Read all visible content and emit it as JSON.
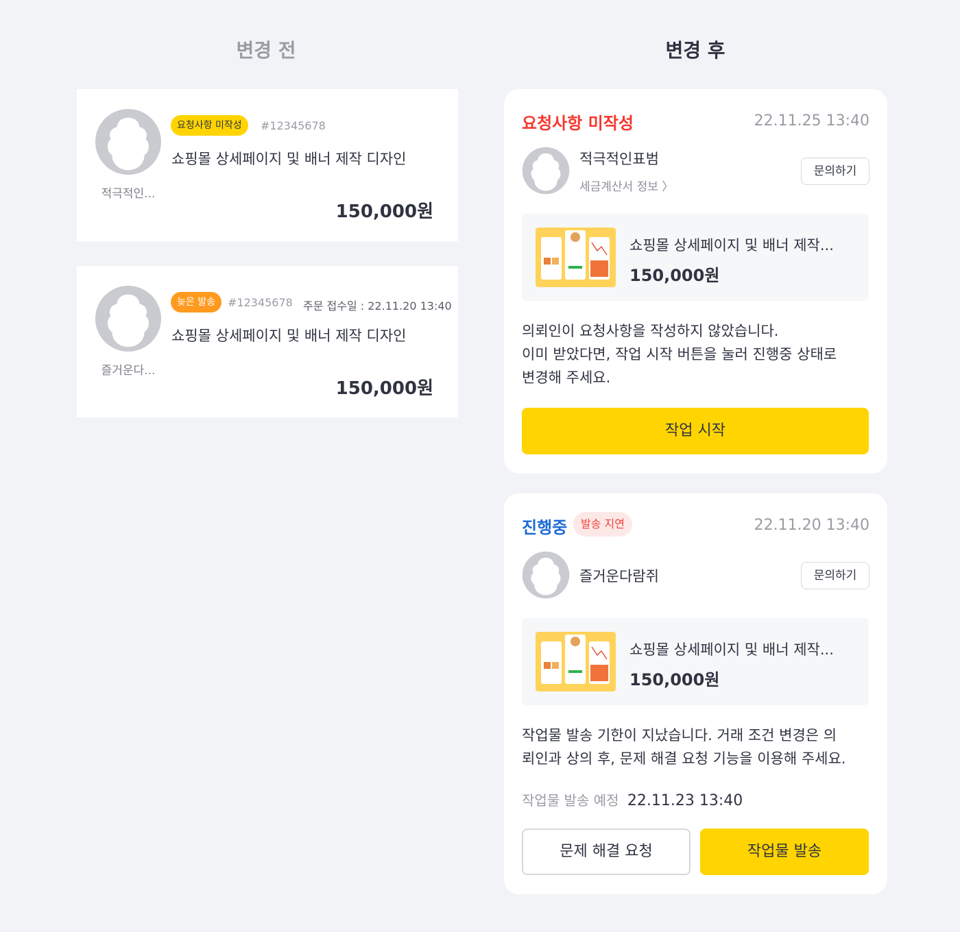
{
  "header": {
    "before_title": "변경 전",
    "after_title": "변경 후"
  },
  "before_cards": [
    {
      "badge": "요청사항 미작성",
      "badge_color": "#ffd400",
      "order_number": "#12345678",
      "order_date": "",
      "title": "쇼핑몰 상세페이지 및 배너 제작 디자인",
      "seller": "적극적인...",
      "price": "150,000원"
    },
    {
      "badge": "늦은 발송",
      "badge_color": "#ff9a1f",
      "order_number": "#12345678",
      "order_date": "주문 접수일 : 22.11.20 13:40",
      "title": "쇼핑몰 상세페이지 및 배너 제작 디자인",
      "seller": "즐거운다...",
      "price": "150,000원"
    }
  ],
  "after_cards": [
    {
      "status": "요청사항 미작성",
      "status_color": "#f5372d",
      "date": "22.11.25 13:40",
      "client_name": "적극적인표범",
      "tax_info_link": "세금계산서 정보 〉",
      "inquiry_button": "문의하기",
      "product_title": "쇼핑몰 상세페이지 및 배너 제작...",
      "product_price": "150,000원",
      "message_lines": [
        "의뢰인이 요청사항을 작성하지 않았습니다.",
        "이미 받았다면, 작업 시작 버튼을 눌러 진행중 상태로",
        "변경해 주세요."
      ],
      "primary_button": "작업 시작"
    },
    {
      "status": "진행중",
      "status_color": "#1d6ad6",
      "delay_badge": "발송 지연",
      "date": "22.11.20 13:40",
      "client_name": "즐거운다람쥐",
      "inquiry_button": "문의하기",
      "product_title": "쇼핑몰 상세페이지 및 배너 제작...",
      "product_price": "150,000원",
      "message_lines": [
        "작업물 발송 기한이 지났습니다. 거래 조건 변경은 의",
        "뢰인과 상의 후, 문제 해결 요청 기능을 이용해 주세요."
      ],
      "schedule_label": "작업물 발송 예정",
      "schedule_value": "22.11.23 13:40",
      "secondary_button": "문제 해결 요청",
      "primary_button": "작업물 발송"
    }
  ],
  "accent_color": "#ffd400"
}
